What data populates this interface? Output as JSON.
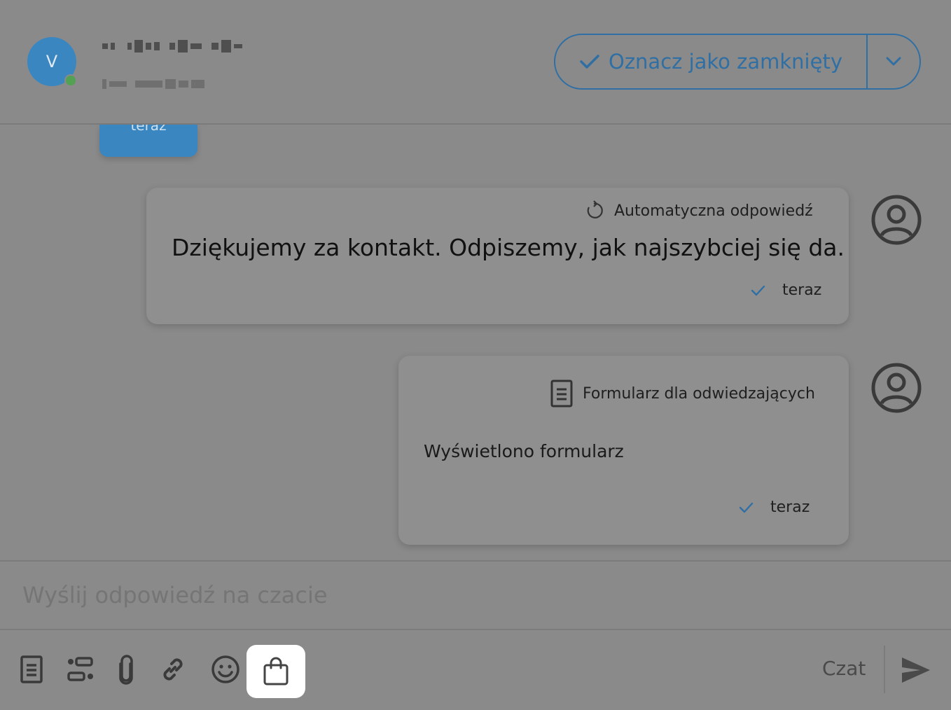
{
  "header": {
    "avatar_letter": "V",
    "close_button_label": "Oznacz jako zamknięty",
    "colors": {
      "accent": "#2f6fa4",
      "avatar": "#3a86c0",
      "online": "#53a153"
    }
  },
  "previous_message": {
    "time": "teraz"
  },
  "messages": [
    {
      "header_label": "Automatyczna odpowiedź",
      "header_icon": "refresh-icon",
      "text": "Dziękujemy za kontakt. Odpiszemy, jak najszybciej się da.",
      "time": "teraz"
    },
    {
      "header_label": "Formularz dla odwiedzających",
      "header_icon": "form-icon",
      "text": "Wyświetlono formularz",
      "time": "teraz"
    }
  ],
  "composer": {
    "placeholder": "Wyślij odpowiedź na czacie",
    "channel_label": "Czat",
    "tools": [
      "template-icon",
      "variables-icon",
      "attachment-icon",
      "link-icon",
      "emoji-icon",
      "shopping-bag-icon"
    ]
  }
}
